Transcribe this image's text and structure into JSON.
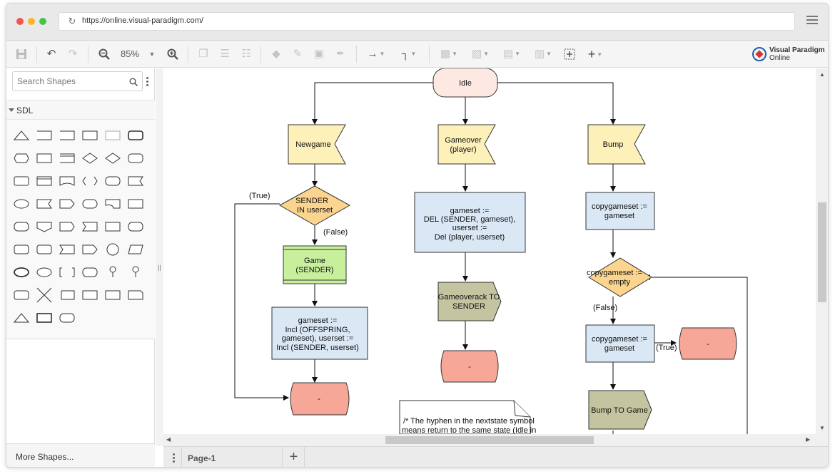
{
  "browser": {
    "url": "https://online.visual-paradigm.com/",
    "dot_colors": [
      "#f1554c",
      "#f7b62e",
      "#3fc748"
    ]
  },
  "toolbar": {
    "zoom_level": "85%",
    "logo_line1": "Visual Paradigm",
    "logo_line2": "Online"
  },
  "sidebar": {
    "search_placeholder": "Search Shapes",
    "category": "SDL",
    "more_shapes": "More Shapes..."
  },
  "pagebar": {
    "page_tab": "Page-1",
    "add_label": "+"
  },
  "diagram": {
    "nodes": {
      "idle": "Idle",
      "newgame": "Newgame",
      "gameover_l1": "Gameover",
      "gameover_l2": "(player)",
      "bump": "Bump",
      "sender_l1": "SENDER",
      "sender_l2": "IN userset",
      "game_l1": "Game",
      "game_l2": "(SENDER)",
      "incl_l1": "gameset :=",
      "incl_l2": "Incl (OFFSPRING,",
      "incl_l3": "gameset), userset :=",
      "incl_l4": "Incl (SENDER, userset)",
      "hyphen1": "-",
      "del_l1": "gameset :=",
      "del_l2": "DEL (SENDER, gameset),",
      "del_l3": "userset :=",
      "del_l4": "Del (player, userset)",
      "gameoverack_l1": "Gameoverack TO",
      "gameoverack_l2": "SENDER",
      "hyphen2": "-",
      "copy1_l1": "copygameset :=",
      "copy1_l2": "gameset",
      "empty_l1": "copygameset :=",
      "empty_l2": "empty",
      "copy2_l1": "copygameset :=",
      "copy2_l2": "gameset",
      "hyphen3": "-",
      "bumptogame": "Bump TO Game",
      "note_l1": "/* The hyphen in the nextstate symbol",
      "note_l2": "means return to the same state (Idle in"
    },
    "edge_labels": {
      "true1": "(True)",
      "false1": "(False)",
      "false2": "(False)",
      "true2": "(True)"
    },
    "colors": {
      "state": "#fde9e1",
      "input": "#fdf1b9",
      "decision": "#fbd58f",
      "task": "#dae8f5",
      "call": "#c8f09c",
      "nextstate": "#f6a797",
      "output": "#c5c4a0"
    }
  }
}
